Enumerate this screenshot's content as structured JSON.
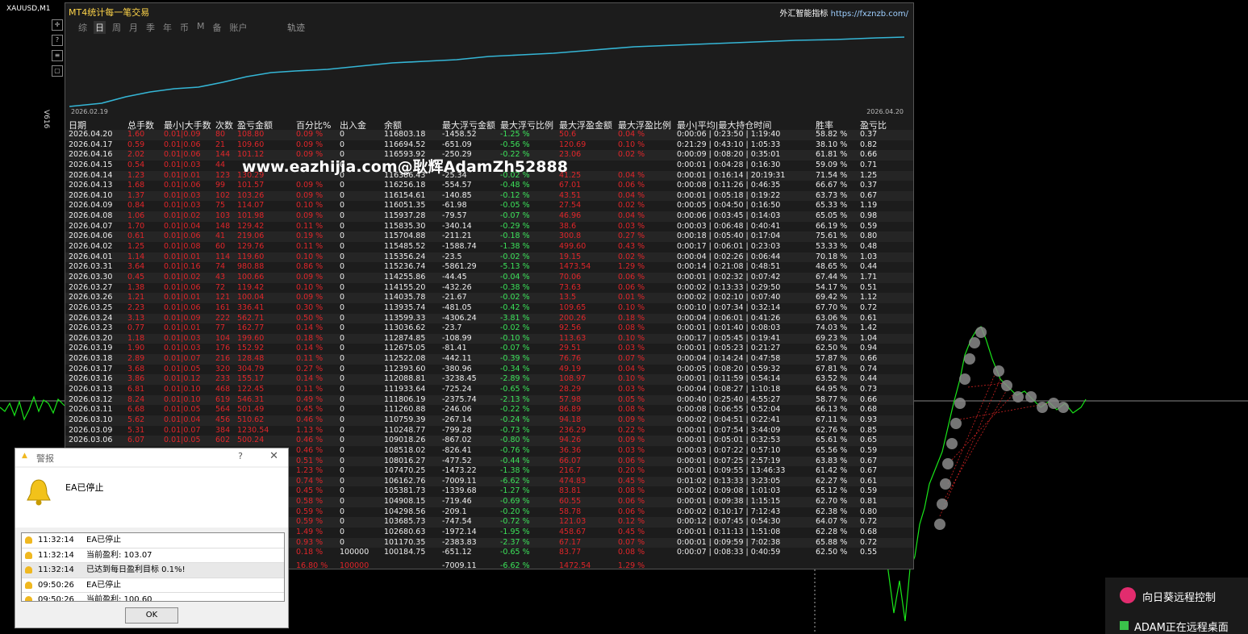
{
  "chart": {
    "symbol": "XAUUSD,M1",
    "version": "V616"
  },
  "panel": {
    "title": "MT4统计每一笔交易",
    "link_label": "外汇智能指标",
    "link_url": "https://fxznzb.com/",
    "tabs": [
      "综",
      "日",
      "周",
      "月",
      "季",
      "年",
      "币",
      "M",
      "备",
      "账户"
    ],
    "trace_label": "轨迹",
    "date_start": "2026.02.19",
    "date_end": "2026.04.20",
    "headers": [
      "日期",
      "总手数",
      "最小|大手数",
      "次数",
      "盈亏金额",
      "百分比%",
      "出入金",
      "余额",
      "最大浮亏金额",
      "最大浮亏比例",
      "最大浮盈金额",
      "最大浮盈比例",
      "最小|平均|最大持仓时间",
      "胜率",
      "盈亏比"
    ]
  },
  "chart_data": {
    "type": "table",
    "columns": [
      "日期",
      "总手数",
      "最小|大手数",
      "次数",
      "盈亏金额",
      "百分比%",
      "出入金",
      "余额",
      "最大浮亏金额",
      "最大浮亏比例",
      "最大浮盈金额",
      "最大浮盈比例",
      "最小|平均|最大持仓时间",
      "胜率",
      "盈亏比"
    ],
    "rows": [
      [
        "2026.04.20",
        "1.60",
        "0.01|0.09",
        "80",
        "108.80",
        "0.09 %",
        "0",
        "116803.18",
        "-1458.52",
        "-1.25 %",
        "50.6",
        "0.04 %",
        "0:00:06 | 0:23:50 | 1:19:40",
        "58.82 %",
        "0.37"
      ],
      [
        "2026.04.17",
        "0.59",
        "0.01|0.06",
        "21",
        "109.60",
        "0.09 %",
        "0",
        "116694.52",
        "-651.09",
        "-0.56 %",
        "120.69",
        "0.10 %",
        "0:21:29 | 0:43:10 | 1:05:33",
        "38.10 %",
        "0.82"
      ],
      [
        "2026.04.16",
        "2.02",
        "0.01|0.06",
        "144",
        "101.12",
        "0.09 %",
        "0",
        "116593.92",
        "-250.29",
        "-0.22 %",
        "23.06",
        "0.02 %",
        "0:00:09 | 0:08:20 | 0:35:01",
        "61.81 %",
        "0.66"
      ],
      [
        "2026.04.15",
        "0.54",
        "0.01|0.03",
        "44",
        "",
        "",
        "0",
        "",
        "",
        "",
        "",
        "",
        "0:00:01 | 0:04:28 | 0:16:30",
        "59.09 %",
        "0.71"
      ],
      [
        "2026.04.14",
        "1.23",
        "0.01|0.01",
        "123",
        "130.29",
        "",
        "0",
        "116386.43",
        "-25.34",
        "-0.02 %",
        "41.25",
        "0.04 %",
        "0:00:01 | 0:16:14 | 20:19:31",
        "71.54 %",
        "1.25"
      ],
      [
        "2026.04.13",
        "1.68",
        "0.01|0.06",
        "99",
        "101.57",
        "0.09 %",
        "0",
        "116256.18",
        "-554.57",
        "-0.48 %",
        "67.01",
        "0.06 %",
        "0:00:08 | 0:11:26 | 0:46:35",
        "66.67 %",
        "0.37"
      ],
      [
        "2026.04.10",
        "1.37",
        "0.01|0.03",
        "102",
        "103.26",
        "0.09 %",
        "0",
        "116154.61",
        "-140.85",
        "-0.12 %",
        "43.51",
        "0.04 %",
        "0:00:01 | 0:05:18 | 0:19:22",
        "63.73 %",
        "0.67"
      ],
      [
        "2026.04.09",
        "0.84",
        "0.01|0.03",
        "75",
        "114.07",
        "0.10 %",
        "0",
        "116051.35",
        "-61.98",
        "-0.05 %",
        "27.54",
        "0.02 %",
        "0:00:05 | 0:04:50 | 0:16:50",
        "65.33 %",
        "1.19"
      ],
      [
        "2026.04.08",
        "1.06",
        "0.01|0.02",
        "103",
        "101.98",
        "0.09 %",
        "0",
        "115937.28",
        "-79.57",
        "-0.07 %",
        "46.96",
        "0.04 %",
        "0:00:06 | 0:03:45 | 0:14:03",
        "65.05 %",
        "0.98"
      ],
      [
        "2026.04.07",
        "1.70",
        "0.01|0.04",
        "148",
        "129.42",
        "0.11 %",
        "0",
        "115835.30",
        "-340.14",
        "-0.29 %",
        "38.6",
        "0.03 %",
        "0:00:03 | 0:06:48 | 0:40:41",
        "66.19 %",
        "0.59"
      ],
      [
        "2026.04.06",
        "0.61",
        "0.01|0.06",
        "41",
        "219.06",
        "0.19 %",
        "0",
        "115704.88",
        "-211.21",
        "-0.18 %",
        "300.8",
        "0.27 %",
        "0:00:18 | 0:05:40 | 0:17:04",
        "75.61 %",
        "0.80"
      ],
      [
        "2026.04.02",
        "1.25",
        "0.01|0.08",
        "60",
        "129.76",
        "0.11 %",
        "0",
        "115485.52",
        "-1588.74",
        "-1.38 %",
        "499.60",
        "0.43 %",
        "0:00:17 | 0:06:01 | 0:23:03",
        "53.33 %",
        "0.48"
      ],
      [
        "2026.04.01",
        "1.14",
        "0.01|0.01",
        "114",
        "119.60",
        "0.10 %",
        "0",
        "115356.24",
        "-23.5",
        "-0.02 %",
        "19.15",
        "0.02 %",
        "0:00:04 | 0:02:26 | 0:06:44",
        "70.18 %",
        "1.03"
      ],
      [
        "2026.03.31",
        "3.64",
        "0.01|0.16",
        "74",
        "980.88",
        "0.86 %",
        "0",
        "115236.74",
        "-5861.29",
        "-5.13 %",
        "1473.54",
        "1.29 %",
        "0:00:14 | 0:21:08 | 0:48:51",
        "48.65 %",
        "0.44"
      ],
      [
        "2026.03.30",
        "0.45",
        "0.01|0.02",
        "43",
        "100.66",
        "0.09 %",
        "0",
        "114255.86",
        "-44.45",
        "-0.04 %",
        "70.06",
        "0.06 %",
        "0:00:01 | 0:02:32 | 0:07:42",
        "67.44 %",
        "1.71"
      ],
      [
        "2026.03.27",
        "1.38",
        "0.01|0.06",
        "72",
        "119.42",
        "0.10 %",
        "0",
        "114155.20",
        "-432.26",
        "-0.38 %",
        "73.63",
        "0.06 %",
        "0:00:02 | 0:13:33 | 0:29:50",
        "54.17 %",
        "0.51"
      ],
      [
        "2026.03.26",
        "1.21",
        "0.01|0.01",
        "121",
        "100.04",
        "0.09 %",
        "0",
        "114035.78",
        "-21.67",
        "-0.02 %",
        "13.5",
        "0.01 %",
        "0:00:02 | 0:02:10 | 0:07:40",
        "69.42 %",
        "1.12"
      ],
      [
        "2026.03.25",
        "2.23",
        "0.01|0.06",
        "161",
        "336.41",
        "0.30 %",
        "0",
        "113935.74",
        "-481.05",
        "-0.42 %",
        "109.65",
        "0.10 %",
        "0:00:10 | 0:07:34 | 0:32:14",
        "67.70 %",
        "0.72"
      ],
      [
        "2026.03.24",
        "3.13",
        "0.01|0.09",
        "222",
        "562.71",
        "0.50 %",
        "0",
        "113599.33",
        "-4306.24",
        "-3.81 %",
        "200.26",
        "0.18 %",
        "0:00:04 | 0:06:01 | 0:41:26",
        "63.06 %",
        "0.61"
      ],
      [
        "2026.03.23",
        "0.77",
        "0.01|0.01",
        "77",
        "162.77",
        "0.14 %",
        "0",
        "113036.62",
        "-23.7",
        "-0.02 %",
        "92.56",
        "0.08 %",
        "0:00:01 | 0:01:40 | 0:08:03",
        "74.03 %",
        "1.42"
      ],
      [
        "2026.03.20",
        "1.18",
        "0.01|0.03",
        "104",
        "199.60",
        "0.18 %",
        "0",
        "112874.85",
        "-108.99",
        "-0.10 %",
        "113.63",
        "0.10 %",
        "0:00:17 | 0:05:45 | 0:19:41",
        "69.23 %",
        "1.04"
      ],
      [
        "2026.03.19",
        "1.90",
        "0.01|0.03",
        "176",
        "152.92",
        "0.14 %",
        "0",
        "112675.05",
        "-81.41",
        "-0.07 %",
        "29.51",
        "0.03 %",
        "0:00:01 | 0:05:23 | 0:21:27",
        "62.50 %",
        "0.94"
      ],
      [
        "2026.03.18",
        "2.89",
        "0.01|0.07",
        "216",
        "128.48",
        "0.11 %",
        "0",
        "112522.08",
        "-442.11",
        "-0.39 %",
        "76.76",
        "0.07 %",
        "0:00:04 | 0:14:24 | 0:47:58",
        "57.87 %",
        "0.66"
      ],
      [
        "2026.03.17",
        "3.68",
        "0.01|0.05",
        "320",
        "304.79",
        "0.27 %",
        "0",
        "112393.60",
        "-380.96",
        "-0.34 %",
        "49.19",
        "0.04 %",
        "0:00:05 | 0:08:20 | 0:59:32",
        "67.81 %",
        "0.74"
      ],
      [
        "2026.03.16",
        "3.86",
        "0.01|0.12",
        "233",
        "155.17",
        "0.14 %",
        "0",
        "112088.81",
        "-3238.45",
        "-2.89 %",
        "108.97",
        "0.10 %",
        "0:00:01 | 0:11:59 | 0:54:14",
        "63.52 %",
        "0.44"
      ],
      [
        "2026.03.13",
        "6.81",
        "0.01|0.10",
        "468",
        "122.45",
        "0.11 %",
        "0",
        "111933.64",
        "-725.24",
        "-0.65 %",
        "28.29",
        "0.03 %",
        "0:00:04 | 0:08:27 | 1:10:18",
        "64.95 %",
        "0.73"
      ],
      [
        "2026.03.12",
        "8.24",
        "0.01|0.10",
        "619",
        "546.31",
        "0.49 %",
        "0",
        "111806.19",
        "-2375.74",
        "-2.13 %",
        "57.98",
        "0.05 %",
        "0:00:40 | 0:25:40 | 4:55:27",
        "58.77 %",
        "0.66"
      ],
      [
        "2026.03.11",
        "6.68",
        "0.01|0.05",
        "564",
        "501.49",
        "0.45 %",
        "0",
        "111260.88",
        "-246.06",
        "-0.22 %",
        "86.89",
        "0.08 %",
        "0:00:08 | 0:06:55 | 0:52:04",
        "66.13 %",
        "0.68"
      ],
      [
        "2026.03.10",
        "5.62",
        "0.01|0.04",
        "456",
        "510.62",
        "0.46 %",
        "0",
        "110759.39",
        "-267.14",
        "-0.24 %",
        "94.18",
        "0.09 %",
        "0:00:02 | 0:04:51 | 0:22:41",
        "67.11 %",
        "0.93"
      ],
      [
        "2026.03.09",
        "5.31",
        "0.01|0.07",
        "384",
        "1230.54",
        "1.13 %",
        "0",
        "110248.77",
        "-799.28",
        "-0.73 %",
        "236.29",
        "0.22 %",
        "0:00:01 | 0:07:54 | 3:44:09",
        "62.76 %",
        "0.85"
      ],
      [
        "2026.03.06",
        "6.07",
        "0.01|0.05",
        "602",
        "500.24",
        "0.46 %",
        "0",
        "109018.26",
        "-867.02",
        "-0.80 %",
        "94.26",
        "0.09 %",
        "0:00:01 | 0:05:01 | 0:32:53",
        "65.61 %",
        "0.65"
      ],
      [
        "",
        "",
        "",
        "",
        "",
        "0.46 %",
        "0",
        "108518.02",
        "-826.41",
        "-0.76 %",
        "36.36",
        "0.03 %",
        "0:00:03 | 0:07:22 | 0:57:10",
        "65.56 %",
        "0.59"
      ],
      [
        "",
        "",
        "",
        "",
        "",
        "0.51 %",
        "0",
        "108016.27",
        "-477.52",
        "-0.44 %",
        "66.07",
        "0.06 %",
        "0:00:01 | 0:07:25 | 2:57:19",
        "63.83 %",
        "0.67"
      ],
      [
        "",
        "",
        "",
        "",
        "",
        "1.23 %",
        "0",
        "107470.25",
        "-1473.22",
        "-1.38 %",
        "216.7",
        "0.20 %",
        "0:00:01 | 0:09:55 | 13:46:33",
        "61.42 %",
        "0.67"
      ],
      [
        "",
        "",
        "",
        "",
        "",
        "0.74 %",
        "0",
        "106162.76",
        "-7009.11",
        "-6.62 %",
        "474.83",
        "0.45 %",
        "0:01:02 | 0:13:33 | 3:23:05",
        "62.27 %",
        "0.61"
      ],
      [
        "",
        "",
        "",
        "",
        "",
        "0.45 %",
        "0",
        "105381.73",
        "-1339.68",
        "-1.27 %",
        "83.81",
        "0.08 %",
        "0:00:02 | 0:09:08 | 1:01:03",
        "65.12 %",
        "0.59"
      ],
      [
        "",
        "",
        "",
        "",
        "",
        "0.58 %",
        "0",
        "104908.15",
        "-719.46",
        "-0.69 %",
        "60.55",
        "0.06 %",
        "0:00:01 | 0:09:38 | 1:15:15",
        "62.70 %",
        "0.81"
      ],
      [
        "",
        "",
        "",
        "",
        "",
        "0.59 %",
        "0",
        "104298.56",
        "-209.1",
        "-0.20 %",
        "58.78",
        "0.06 %",
        "0:00:02 | 0:10:17 | 7:12:43",
        "62.38 %",
        "0.80"
      ],
      [
        "",
        "",
        "",
        "",
        "",
        "0.59 %",
        "0",
        "103685.73",
        "-747.54",
        "-0.72 %",
        "121.03",
        "0.12 %",
        "0:00:12 | 0:07:45 | 0:54:30",
        "64.07 %",
        "0.72"
      ],
      [
        "",
        "",
        "",
        "",
        "",
        "1.49 %",
        "0",
        "102680.63",
        "-1972.14",
        "-1.95 %",
        "458.67",
        "0.45 %",
        "0:00:01 | 0:11:13 | 1:51:08",
        "62.28 %",
        "0.68"
      ],
      [
        "",
        "",
        "",
        "",
        "",
        "0.93 %",
        "0",
        "101170.35",
        "-2383.83",
        "-2.37 %",
        "67.17",
        "0.07 %",
        "0:00:01 | 0:09:59 | 7:02:38",
        "65.88 %",
        "0.72"
      ],
      [
        "",
        "",
        "",
        "",
        "",
        "0.18 %",
        "100000",
        "100184.75",
        "-651.12",
        "-0.65 %",
        "83.77",
        "0.08 %",
        "0:00:07 | 0:08:33 | 0:40:59",
        "62.50 %",
        "0.55"
      ]
    ],
    "totals": [
      "16.80 %",
      "100000",
      "",
      "-7009.11",
      "-6.62 %",
      "1472.54",
      "1.29 %"
    ]
  },
  "watermark": "www.eazhijia.com@耿辉AdamZh52888",
  "alert": {
    "title": "警报",
    "help": "?",
    "close": "✕",
    "message": "EA已停止",
    "log": [
      {
        "time": "11:32:14",
        "msg": "EA已停止"
      },
      {
        "time": "11:32:14",
        "msg": "当前盈利: 103.07"
      },
      {
        "time": "11:32:14",
        "msg": "已达到每日盈利目标 0.1%!"
      },
      {
        "time": "09:50:26",
        "msg": "EA已停止"
      },
      {
        "time": "09:50:26",
        "msg": "当前盈利: 100.60"
      }
    ],
    "ok": "OK"
  },
  "remote": {
    "line1": "向日葵远程控制",
    "line2": "ADAM正在远程桌面"
  },
  "colors": {
    "loss": "#e0262a",
    "gain": "#3ce35a",
    "curve": "#35b6d6",
    "title": "#ffd54a"
  }
}
